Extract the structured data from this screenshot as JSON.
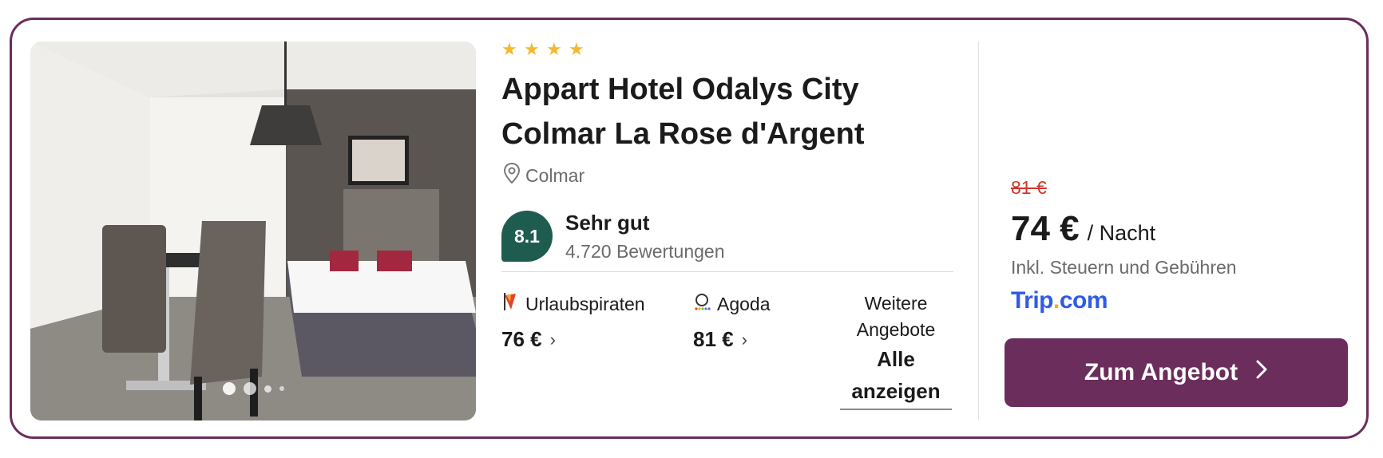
{
  "hotel": {
    "stars": 4,
    "name": "Appart Hotel Odalys City Colmar La Rose d'Argent",
    "location": "Colmar",
    "rating_score": "8.1",
    "rating_label": "Sehr gut",
    "rating_count": "4.720 Bewertungen",
    "photo_slides": 4
  },
  "offers": [
    {
      "provider": "Urlaubspiraten",
      "price": "76 €",
      "icon": "pirate-flag-icon"
    },
    {
      "provider": "Agoda",
      "price": "81 €",
      "icon": "agoda-logo-icon"
    }
  ],
  "more_offers": {
    "label": "Weitere Angebote",
    "link": "Alle anzeigen"
  },
  "pricing": {
    "old_price": "81 €",
    "price": "74 €",
    "unit": "/ Nacht",
    "tax_note": "Inkl. Steuern und Gebühren",
    "brand_name": "Trip",
    "brand_dot": ".",
    "brand_suffix": "com",
    "cta_label": "Zum Angebot"
  },
  "colors": {
    "accent": "#6b2d5c",
    "rating_badge": "#1f5c50",
    "old_price": "#d0362b",
    "brand": "#2f5be6",
    "star": "#f5b82e"
  }
}
